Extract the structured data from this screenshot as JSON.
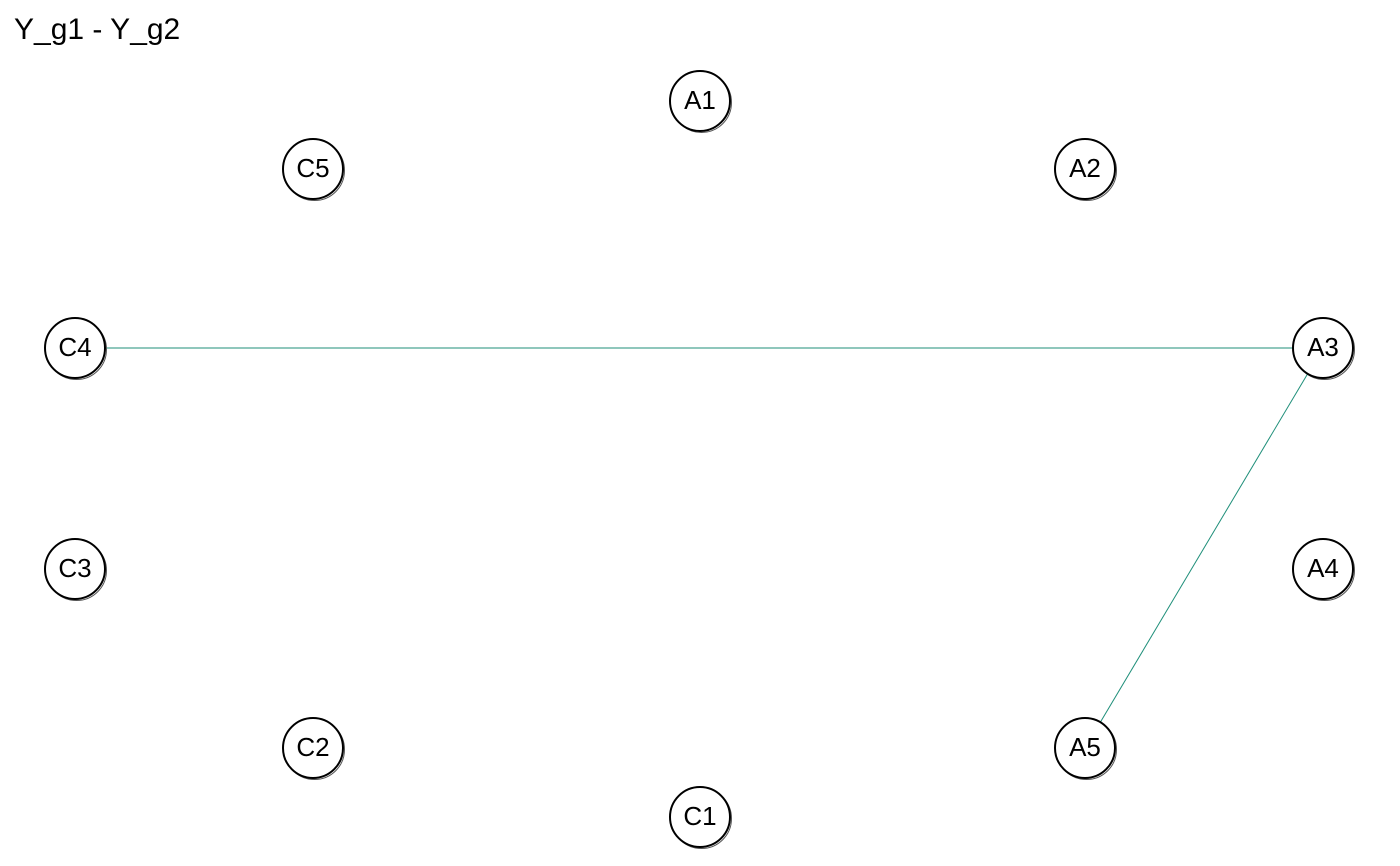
{
  "title": "Y_g1 - Y_g2",
  "colors": {
    "edge": "#1f8f7a",
    "node_stroke": "#000000",
    "node_fill": "#ffffff",
    "text": "#000000"
  },
  "nodes": [
    {
      "id": "A1",
      "label": "A1"
    },
    {
      "id": "A2",
      "label": "A2"
    },
    {
      "id": "A3",
      "label": "A3"
    },
    {
      "id": "A4",
      "label": "A4"
    },
    {
      "id": "A5",
      "label": "A5"
    },
    {
      "id": "C1",
      "label": "C1"
    },
    {
      "id": "C2",
      "label": "C2"
    },
    {
      "id": "C3",
      "label": "C3"
    },
    {
      "id": "C4",
      "label": "C4"
    },
    {
      "id": "C5",
      "label": "C5"
    }
  ],
  "edges": [
    {
      "from": "C4",
      "to": "A3"
    },
    {
      "from": "A3",
      "to": "A5"
    }
  ]
}
